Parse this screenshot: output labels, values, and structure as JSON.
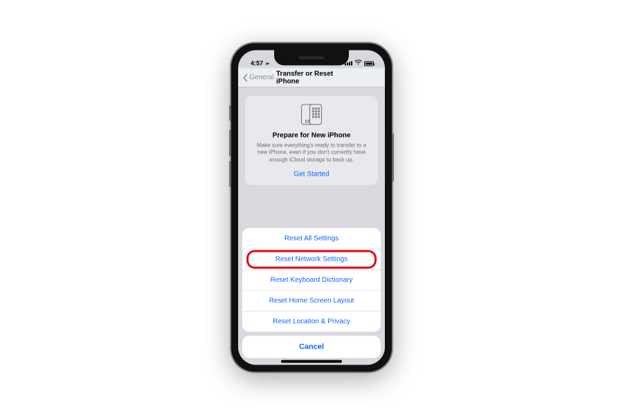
{
  "status": {
    "time": "4:57",
    "loc_glyph": "➢"
  },
  "nav": {
    "back_label": "General",
    "title": "Transfer or Reset iPhone"
  },
  "prepare": {
    "heading": "Prepare for New iPhone",
    "body": "Make sure everything's ready to transfer to a new iPhone, even if you don't currently have enough iCloud storage to back up.",
    "cta": "Get Started"
  },
  "sheet": {
    "items": [
      "Reset All Settings",
      "Reset Network Settings",
      "Reset Keyboard Dictionary",
      "Reset Home Screen Layout",
      "Reset Location & Privacy"
    ],
    "cancel": "Cancel",
    "highlight_index": 1
  }
}
